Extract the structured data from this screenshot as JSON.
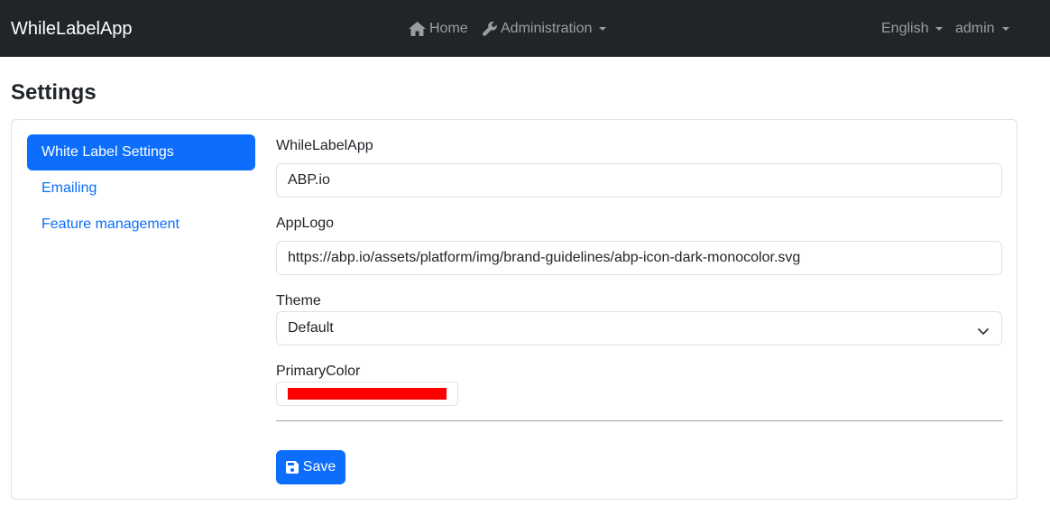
{
  "navbar": {
    "brand": "WhileLabelApp",
    "items": [
      {
        "label": "Home",
        "icon": "home-icon"
      },
      {
        "label": "Administration",
        "icon": "wrench-icon"
      }
    ],
    "language": "English",
    "user": "admin"
  },
  "page": {
    "title": "Settings"
  },
  "sidebar": {
    "items": [
      {
        "label": "White Label Settings",
        "active": true
      },
      {
        "label": "Emailing",
        "active": false
      },
      {
        "label": "Feature management",
        "active": false
      }
    ]
  },
  "form": {
    "app_name": {
      "label": "WhileLabelApp",
      "value": "ABP.io"
    },
    "app_logo": {
      "label": "AppLogo",
      "value": "https://abp.io/assets/platform/img/brand-guidelines/abp-icon-dark-monocolor.svg"
    },
    "theme": {
      "label": "Theme",
      "value": "Default"
    },
    "primary_color": {
      "label": "PrimaryColor",
      "value": "#ff0000"
    },
    "save_label": "Save"
  },
  "colors": {
    "navbar_bg": "#212529",
    "accent": "#0d6efd"
  }
}
